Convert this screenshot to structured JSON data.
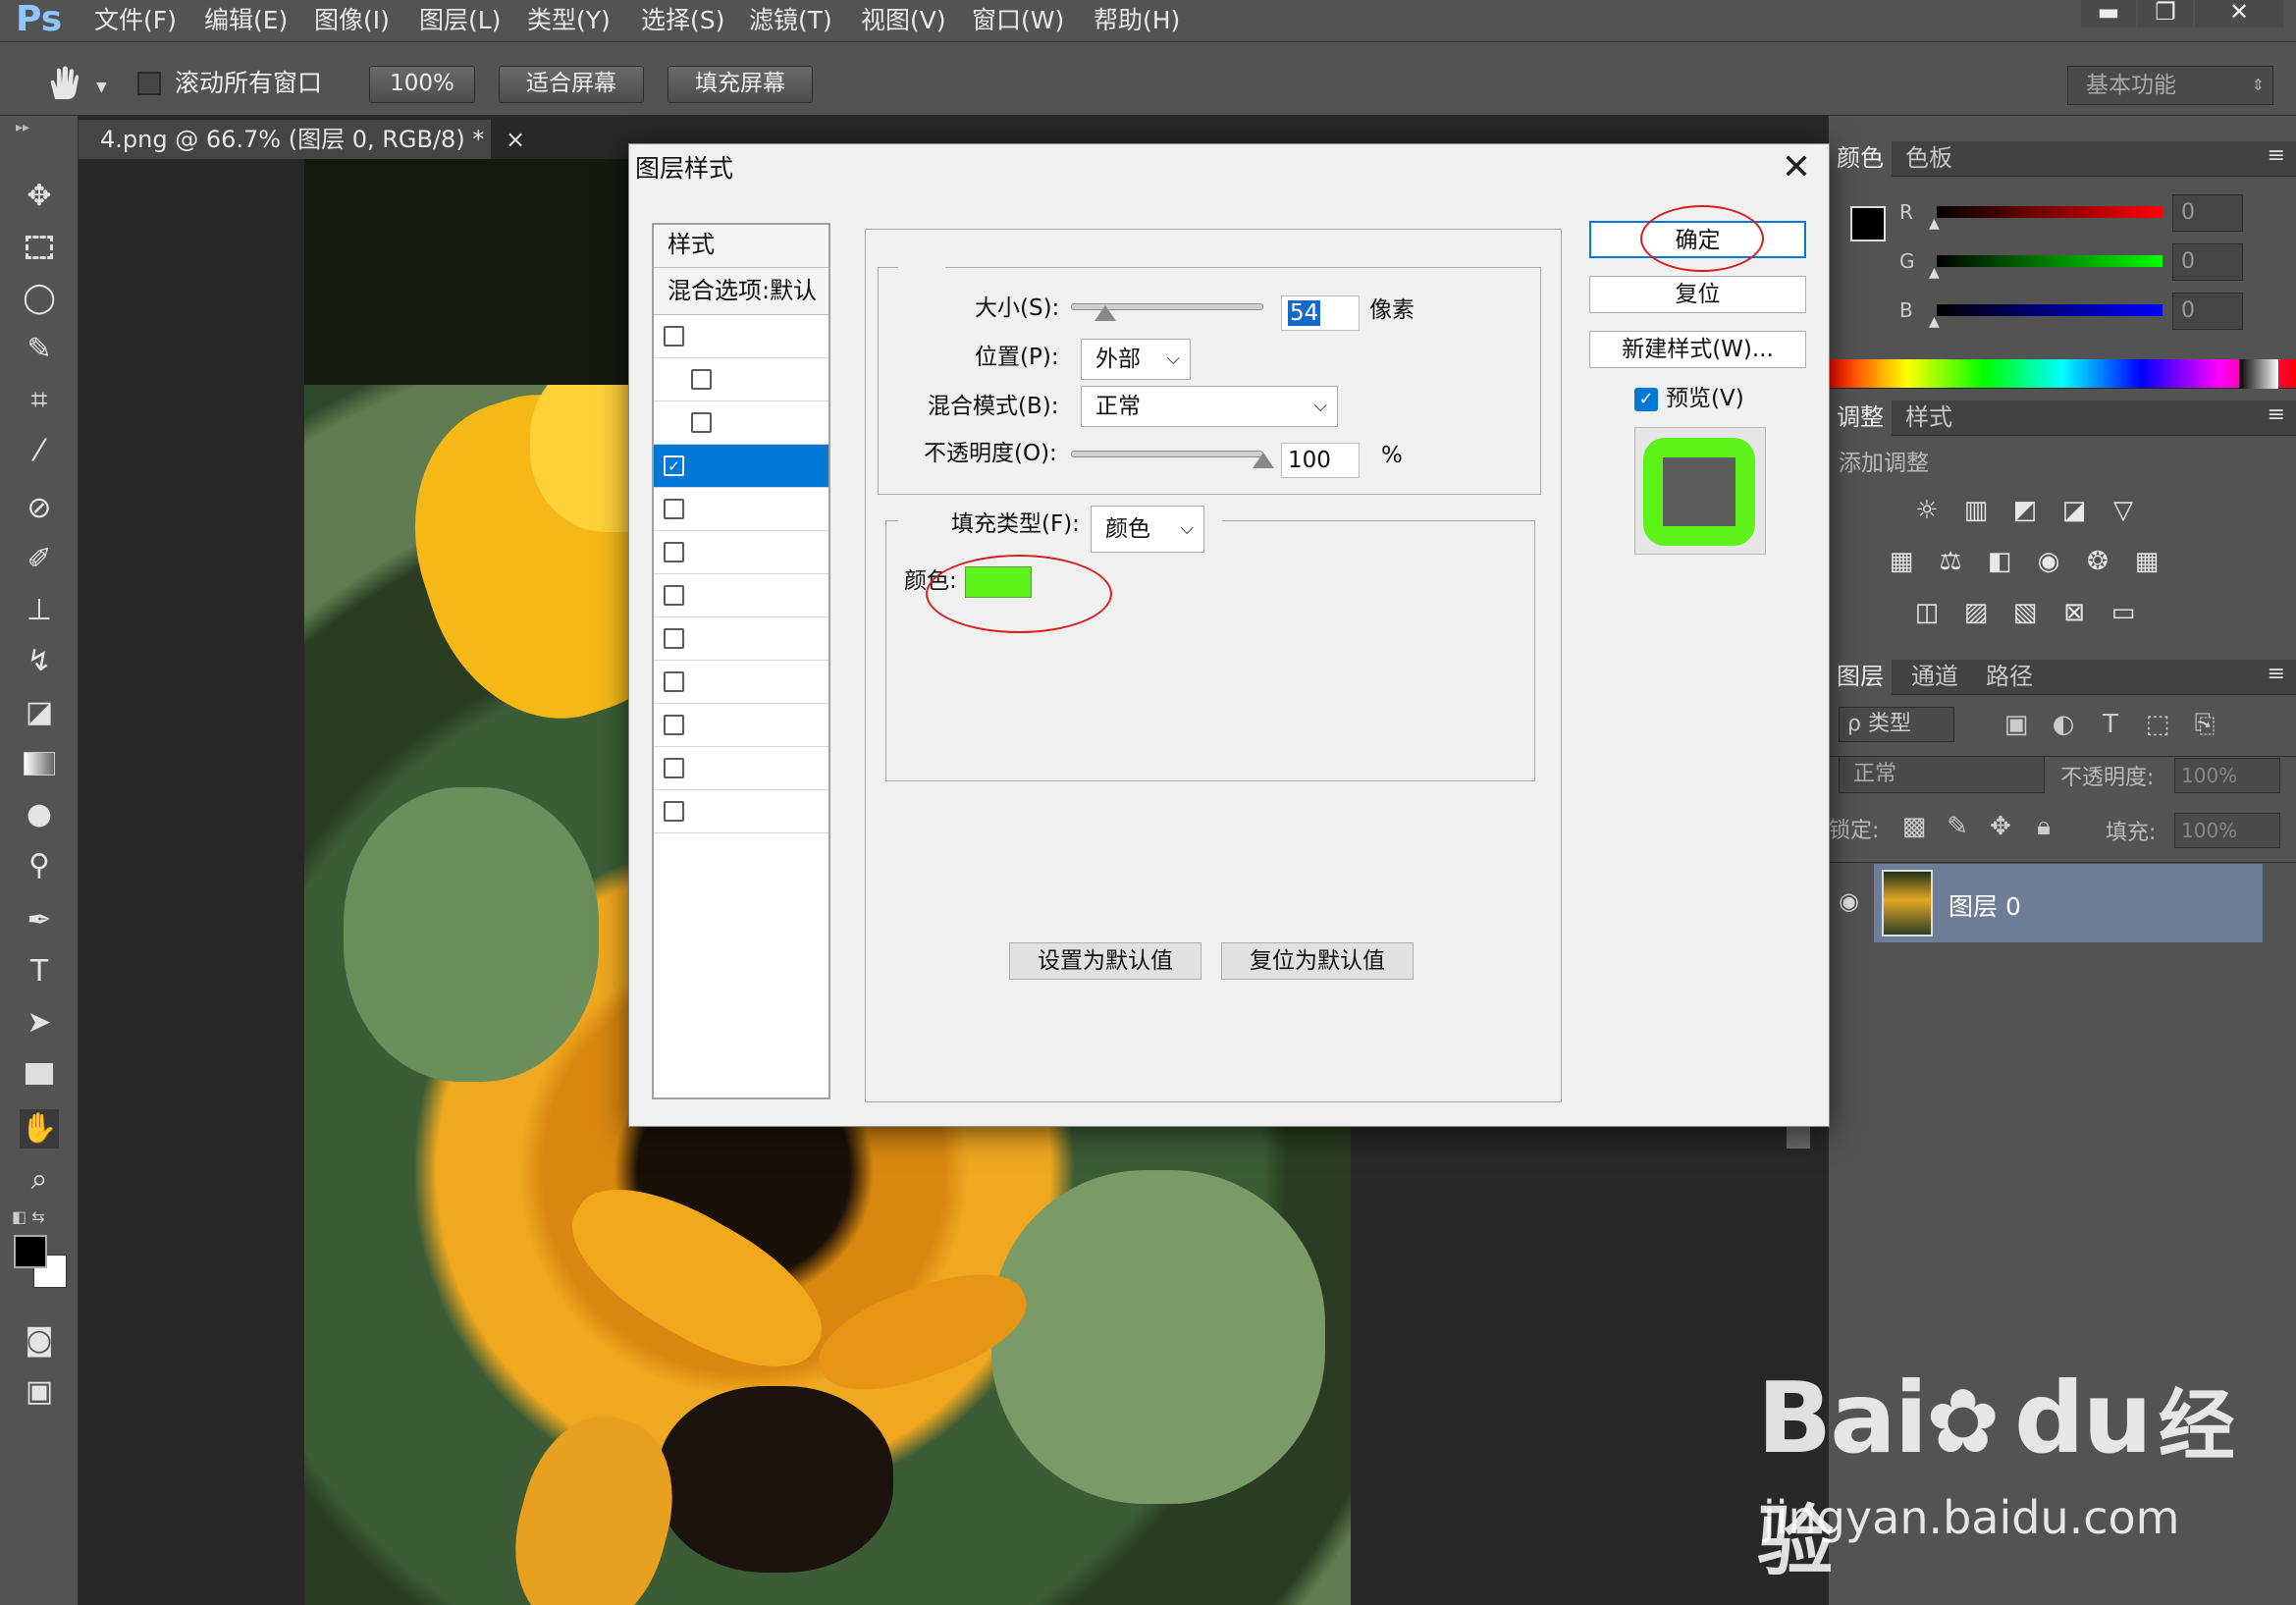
{
  "app": {
    "logo": "Ps"
  },
  "menu": [
    "文件(F)",
    "编辑(E)",
    "图像(I)",
    "图层(L)",
    "类型(Y)",
    "选择(S)",
    "滤镜(T)",
    "视图(V)",
    "窗口(W)",
    "帮助(H)"
  ],
  "window_controls": {
    "minimize": "▬",
    "restore": "❐",
    "close": "✕"
  },
  "options_bar": {
    "scroll_all_label": "滚动所有窗口",
    "zoom_100": "100%",
    "fit_screen": "适合屏幕",
    "fill_screen": "填充屏幕",
    "workspace": "基本功能"
  },
  "document": {
    "tab_label": "4.png @ 66.7% (图层 0, RGB/8) *",
    "tab_close": "×"
  },
  "dialog": {
    "title": "图层样式",
    "close_glyph": "✕",
    "styles_header": "样式",
    "blend_options": "混合选项:默认",
    "style_rows": [
      {
        "checked": false,
        "indent": false
      },
      {
        "checked": false,
        "indent": true
      },
      {
        "checked": false,
        "indent": true
      },
      {
        "checked": true,
        "indent": false,
        "selected": true
      },
      {
        "checked": false,
        "indent": false
      },
      {
        "checked": false,
        "indent": false
      },
      {
        "checked": false,
        "indent": false
      },
      {
        "checked": false,
        "indent": false
      },
      {
        "checked": false,
        "indent": false
      },
      {
        "checked": false,
        "indent": false
      },
      {
        "checked": false,
        "indent": false
      },
      {
        "checked": false,
        "indent": false
      }
    ],
    "structure": {
      "size_label": "大小(S):",
      "size_value": "54",
      "size_unit": "像素",
      "size_slider": 0.18,
      "position_label": "位置(P):",
      "position_value": "外部",
      "blend_label": "混合模式(B):",
      "blend_value": "正常",
      "opacity_label": "不透明度(O):",
      "opacity_value": "100",
      "opacity_unit": "%",
      "opacity_slider": 1.0
    },
    "fill": {
      "type_label": "填充类型(F):",
      "type_value": "颜色",
      "color_label": "颜色:",
      "color": "#5df21a"
    },
    "set_default": "设置为默认值",
    "reset_default": "复位为默认值",
    "ok": "确定",
    "reset": "复位",
    "new_style": "新建样式(W)...",
    "preview_label": "预览(V)",
    "preview_checked": true,
    "preview_stroke_color": "#5df21a"
  },
  "color_panel": {
    "tabs": [
      "颜色",
      "色板"
    ],
    "channels": [
      {
        "name": "R",
        "value": "0",
        "color": "#ff0000"
      },
      {
        "name": "G",
        "value": "0",
        "color": "#00ff00"
      },
      {
        "name": "B",
        "value": "0",
        "color": "#0000ff"
      }
    ]
  },
  "adjust_panel": {
    "tabs": [
      "调整",
      "样式"
    ],
    "add_label": "添加调整"
  },
  "layers_panel": {
    "tabs": [
      "图层",
      "通道",
      "路径"
    ],
    "filter_kind": "ρ 类型",
    "blend_mode": "正常",
    "opacity_label": "不透明度:",
    "opacity_value": "100%",
    "lock_label": "锁定:",
    "fill_label": "填充:",
    "fill_value": "100%",
    "layers": [
      {
        "name": "图层 0",
        "visible": true
      }
    ]
  },
  "watermark": {
    "brand": "Bai",
    "brand2": "du",
    "cn": "经验",
    "url": "jingyan.baidu.com"
  },
  "icons": {
    "hand": "hand-icon",
    "move": "move-icon",
    "marquee": "marquee-icon",
    "lasso": "lasso-icon",
    "eye": "eye-icon"
  }
}
